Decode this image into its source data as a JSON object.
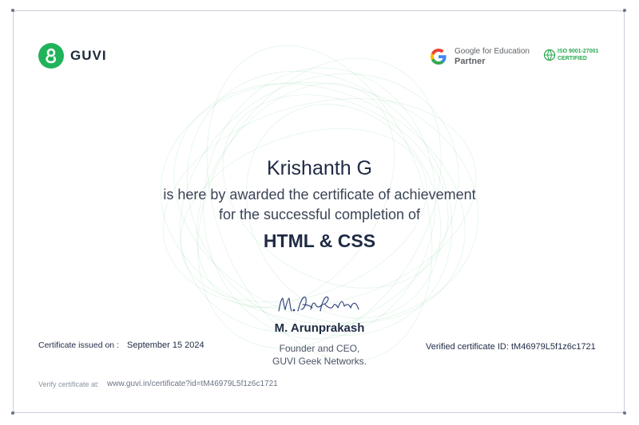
{
  "brand": {
    "name": "GUVI",
    "color": "#21b35a"
  },
  "partner": {
    "line1": "Google for Education",
    "line2": "Partner"
  },
  "iso": {
    "line1": "ISO 9001-27001",
    "line2": "CERTIFIED"
  },
  "certificate": {
    "recipient": "Krishanth G",
    "line1": "is here by awarded the certificate of achievement",
    "line2": "for the successful completion of",
    "course": "HTML & CSS"
  },
  "signatory": {
    "name": "M. Arunprakash",
    "role_line1": "Founder and CEO,",
    "role_line2": "GUVI Geek Networks."
  },
  "issued": {
    "label": "Certificate issued on :",
    "date": "September 15 2024"
  },
  "verified": {
    "text": "Verified certificate ID: tM46979L5f1z6c1721"
  },
  "verify": {
    "label": "Verify certificate at:",
    "url": "www.guvi.in/certificate?id=tM46979L5f1z6c1721"
  },
  "icons": {
    "logo": "guvi-logo-icon",
    "google": "google-g-icon",
    "iso": "iso-globe-icon",
    "signature": "signature-icon"
  }
}
